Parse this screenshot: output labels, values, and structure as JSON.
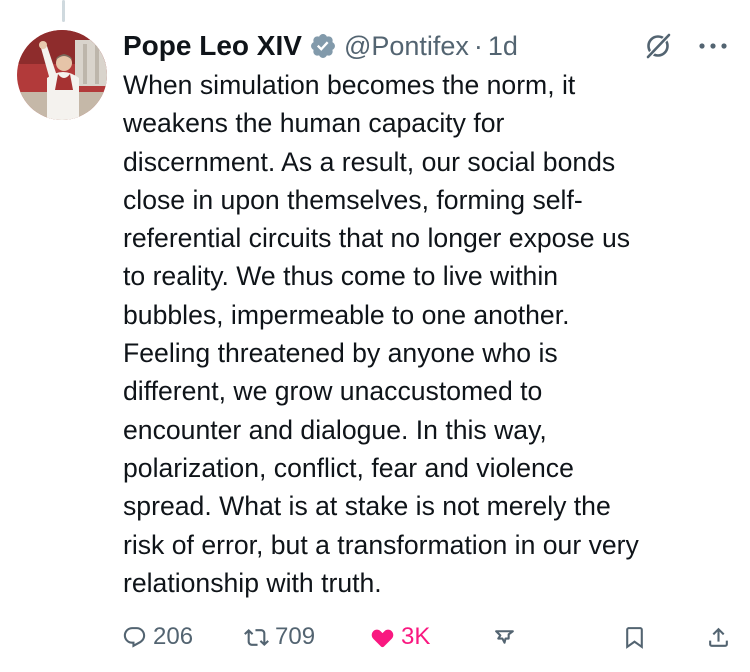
{
  "author": {
    "name": "Pope Leo XIV",
    "handle": "@Pontifex",
    "separator": "·",
    "time": "1d",
    "verified_color": "#829aab"
  },
  "post": {
    "text": "When simulation becomes the norm, it\nweakens the human capacity for\ndiscernment.  As a result, our social bonds\nclose in upon themselves, forming self-\nreferential circuits that no longer expose us\nto reality.  We thus come to live within\nbubbles, impermeable to one another.\nFeeling threatened by anyone who is\ndifferent, we grow unaccustomed to\nencounter and dialogue.  In this way,\npolarization, conflict, fear and violence\nspread.  What is at stake is not merely the\nrisk of error, but a transformation in our very\nrelationship with truth."
  },
  "actions": {
    "replies": "206",
    "reposts": "709",
    "likes": "3K",
    "like_color": "#f91880",
    "muted_color": "#536471"
  },
  "icons": {
    "verified": "verified-badge-icon",
    "grok": "grok-icon",
    "more": "more-icon",
    "reply": "reply-icon",
    "repost": "repost-icon",
    "like": "heart-icon",
    "views": "views-icon",
    "bookmark": "bookmark-icon",
    "share": "share-icon"
  }
}
